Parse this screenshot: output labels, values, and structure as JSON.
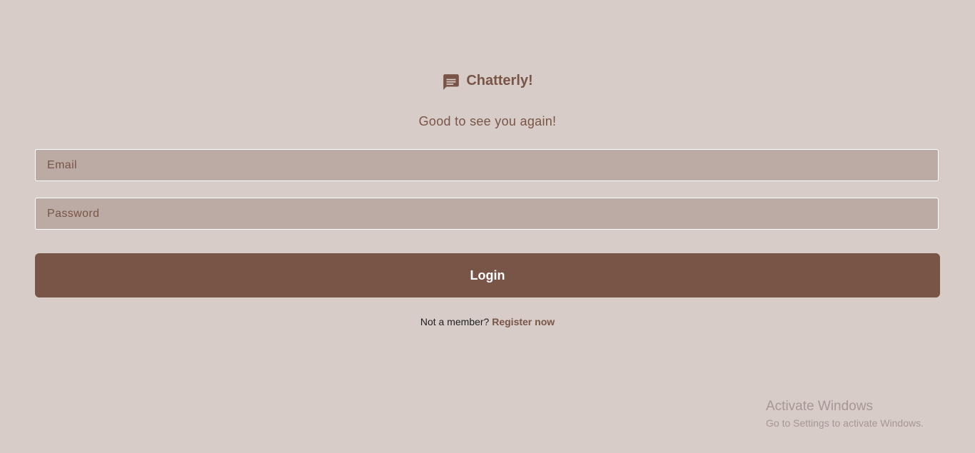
{
  "app": {
    "title": "Chatterly!",
    "icon": "chat-bubble-icon",
    "subtitle": "Good to see you again!"
  },
  "form": {
    "email_placeholder": "Email",
    "password_placeholder": "Password",
    "login_label": "Login"
  },
  "register": {
    "prompt": "Not a member?",
    "link_label": "Register now"
  },
  "watermark": {
    "title": "Activate Windows",
    "subtitle": "Go to Settings to activate Windows."
  },
  "colors": {
    "background": "#d7ccc8",
    "accent": "#795548",
    "field_background": "#bcaaa4",
    "button_text": "#ffffff"
  }
}
